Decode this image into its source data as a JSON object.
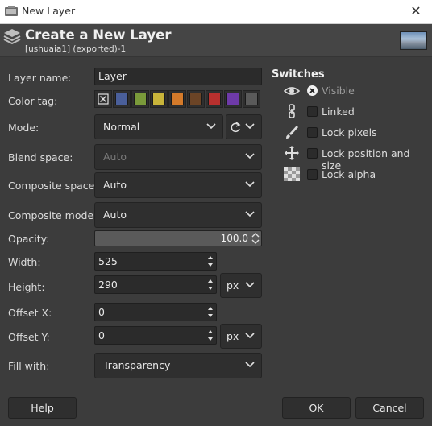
{
  "window": {
    "title": "New Layer"
  },
  "header": {
    "title": "Create a New Layer",
    "subtitle": "[ushuaia1] (exported)-1"
  },
  "form": {
    "layer_name_label": "Layer name:",
    "layer_name_value": "Layer",
    "color_tag_label": "Color tag:",
    "color_tags": [
      "none",
      "#4a5f9a",
      "#7a9a3a",
      "#c8b43a",
      "#d47a2a",
      "#6b4426",
      "#b8302e",
      "#6e3aa8",
      "#5a5a5a"
    ],
    "mode_label": "Mode:",
    "mode_value": "Normal",
    "blend_space_label": "Blend space:",
    "blend_space_value": "Auto",
    "composite_space_label": "Composite space:",
    "composite_space_value": "Auto",
    "composite_mode_label": "Composite mode:",
    "composite_mode_value": "Auto",
    "opacity_label": "Opacity:",
    "opacity_value": "100.0",
    "width_label": "Width:",
    "width_value": "525",
    "height_label": "Height:",
    "height_value": "290",
    "size_unit": "px",
    "offset_x_label": "Offset X:",
    "offset_x_value": "0",
    "offset_y_label": "Offset Y:",
    "offset_y_value": "0",
    "offset_unit": "px",
    "fill_label": "Fill with:",
    "fill_value": "Transparency"
  },
  "switches": {
    "title": "Switches",
    "visible": "Visible",
    "linked": "Linked",
    "lock_pixels": "Lock pixels",
    "lock_position": "Lock position and size",
    "lock_alpha": "Lock alpha"
  },
  "buttons": {
    "help": "Help",
    "ok": "OK",
    "cancel": "Cancel"
  }
}
